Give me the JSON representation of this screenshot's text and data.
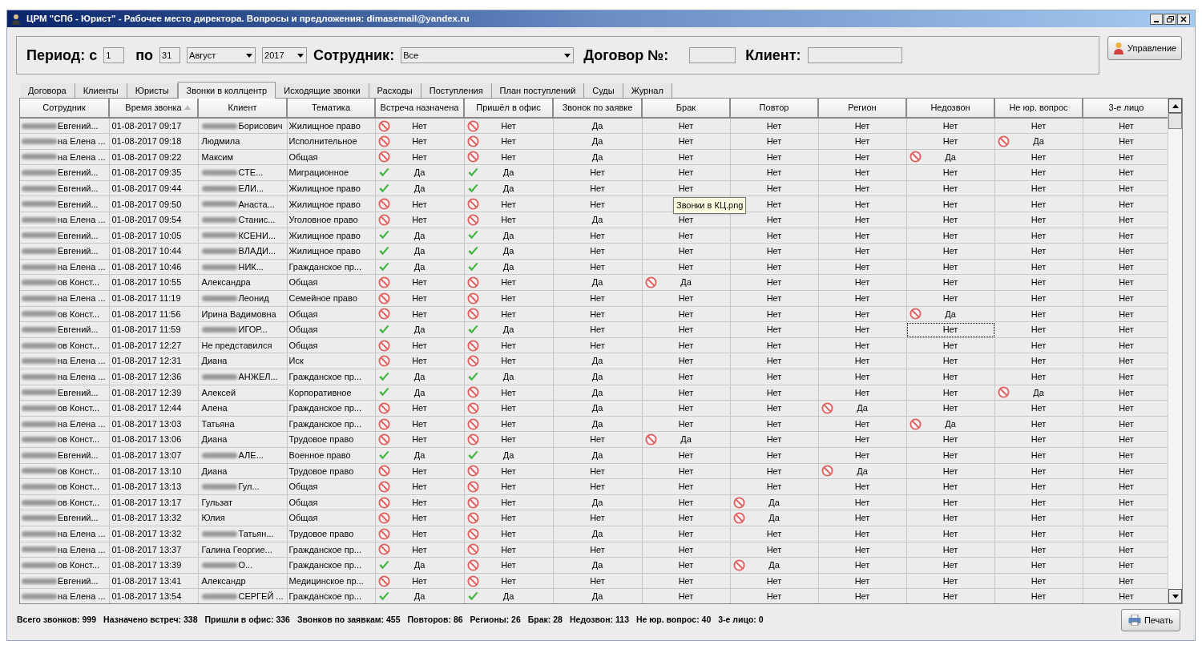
{
  "window": {
    "title": "ЦРМ \"СПб - Юрист\" - Рабочее место директора. Вопросы и предложения: dimasemail@yandex.ru"
  },
  "filter": {
    "period_label": "Период: с",
    "from": "1",
    "to_label": "по",
    "to": "31",
    "month": "Август",
    "year": "2017",
    "employee_label": "Сотрудник:",
    "employee": "Все",
    "contract_label": "Договор №:",
    "client_label": "Клиент:"
  },
  "manage_button": "Управление",
  "tabs": [
    {
      "label": "Договора",
      "selected": false
    },
    {
      "label": "Клиенты",
      "selected": false
    },
    {
      "label": "Юристы",
      "selected": false
    },
    {
      "label": "Звонки в коллцентр",
      "selected": true
    },
    {
      "label": "Исходящие звонки",
      "selected": false
    },
    {
      "label": "Расходы",
      "selected": false
    },
    {
      "label": "Поступления",
      "selected": false
    },
    {
      "label": "План поступлений",
      "selected": false
    },
    {
      "label": "Суды",
      "selected": false
    },
    {
      "label": "Журнал",
      "selected": false
    }
  ],
  "table": {
    "columns": [
      {
        "label": "Сотрудник",
        "sorted": false
      },
      {
        "label": "Время звонка",
        "sorted": true
      },
      {
        "label": "Клиент",
        "sorted": false
      },
      {
        "label": "Тематика",
        "sorted": false
      },
      {
        "label": "Встреча назначена",
        "sorted": false
      },
      {
        "label": "Пришёл в офис",
        "sorted": false
      },
      {
        "label": "Звонок по заявке",
        "sorted": false
      },
      {
        "label": "Брак",
        "sorted": false
      },
      {
        "label": "Повтор",
        "sorted": false
      },
      {
        "label": "Регион",
        "sorted": false
      },
      {
        "label": "Недозвон",
        "sorted": false
      },
      {
        "label": "Не юр. вопрос",
        "sorted": false
      },
      {
        "label": "3-е лицо",
        "sorted": false
      }
    ],
    "rows": [
      {
        "employee": "Евгений...",
        "time": "01-08-2017 09:17",
        "client": "Борисович",
        "client_blurred": true,
        "topic": "Жилищное право",
        "flags": [
          {
            "text": "Нет",
            "kind": "no"
          },
          {
            "text": "Нет",
            "kind": "no"
          },
          {
            "text": "Да",
            "kind": "plain"
          },
          {
            "text": "Нет",
            "kind": "plain"
          },
          {
            "text": "Нет",
            "kind": "plain"
          },
          {
            "text": "Нет",
            "kind": "plain"
          },
          {
            "text": "Нет",
            "kind": "plain"
          },
          {
            "text": "Нет",
            "kind": "plain"
          },
          {
            "text": "Нет",
            "kind": "plain"
          }
        ]
      },
      {
        "employee": "на Елена ...",
        "time": "01-08-2017 09:18",
        "client": "Людмила",
        "client_blurred": false,
        "topic": "Исполнительное",
        "flags": [
          {
            "text": "Нет",
            "kind": "no"
          },
          {
            "text": "Нет",
            "kind": "no"
          },
          {
            "text": "Да",
            "kind": "plain"
          },
          {
            "text": "Нет",
            "kind": "plain"
          },
          {
            "text": "Нет",
            "kind": "plain"
          },
          {
            "text": "Нет",
            "kind": "plain"
          },
          {
            "text": "Нет",
            "kind": "plain"
          },
          {
            "text": "Да",
            "kind": "no"
          },
          {
            "text": "Нет",
            "kind": "plain"
          }
        ]
      },
      {
        "employee": "на Елена ...",
        "time": "01-08-2017 09:22",
        "client": "Максим",
        "client_blurred": false,
        "topic": "Общая",
        "flags": [
          {
            "text": "Нет",
            "kind": "no"
          },
          {
            "text": "Нет",
            "kind": "no"
          },
          {
            "text": "Да",
            "kind": "plain"
          },
          {
            "text": "Нет",
            "kind": "plain"
          },
          {
            "text": "Нет",
            "kind": "plain"
          },
          {
            "text": "Нет",
            "kind": "plain"
          },
          {
            "text": "Да",
            "kind": "no"
          },
          {
            "text": "Нет",
            "kind": "plain"
          },
          {
            "text": "Нет",
            "kind": "plain"
          }
        ]
      },
      {
        "employee": "Евгений...",
        "time": "01-08-2017 09:35",
        "client": "СТЕ...",
        "client_blurred": true,
        "topic": "Миграционное",
        "flags": [
          {
            "text": "Да",
            "kind": "yes"
          },
          {
            "text": "Да",
            "kind": "yes"
          },
          {
            "text": "Нет",
            "kind": "plain"
          },
          {
            "text": "Нет",
            "kind": "plain"
          },
          {
            "text": "Нет",
            "kind": "plain"
          },
          {
            "text": "Нет",
            "kind": "plain"
          },
          {
            "text": "Нет",
            "kind": "plain"
          },
          {
            "text": "Нет",
            "kind": "plain"
          },
          {
            "text": "Нет",
            "kind": "plain"
          }
        ]
      },
      {
        "employee": "Евгений...",
        "time": "01-08-2017 09:44",
        "client": "ЕЛИ...",
        "client_blurred": true,
        "topic": "Жилищное право",
        "flags": [
          {
            "text": "Да",
            "kind": "yes"
          },
          {
            "text": "Да",
            "kind": "yes"
          },
          {
            "text": "Нет",
            "kind": "plain"
          },
          {
            "text": "Нет",
            "kind": "plain"
          },
          {
            "text": "Нет",
            "kind": "plain"
          },
          {
            "text": "Нет",
            "kind": "plain"
          },
          {
            "text": "Нет",
            "kind": "plain"
          },
          {
            "text": "Нет",
            "kind": "plain"
          },
          {
            "text": "Нет",
            "kind": "plain"
          }
        ]
      },
      {
        "employee": "Евгений...",
        "time": "01-08-2017 09:50",
        "client": "Анаста...",
        "client_blurred": true,
        "topic": "Жилищное право",
        "flags": [
          {
            "text": "Нет",
            "kind": "no"
          },
          {
            "text": "Нет",
            "kind": "no"
          },
          {
            "text": "Нет",
            "kind": "plain"
          },
          {
            "kind": "covered"
          },
          {
            "text": "Нет",
            "kind": "plain"
          },
          {
            "text": "Нет",
            "kind": "plain"
          },
          {
            "text": "Нет",
            "kind": "plain"
          },
          {
            "text": "Нет",
            "kind": "plain"
          },
          {
            "text": "Нет",
            "kind": "plain"
          }
        ]
      },
      {
        "employee": "на Елена ...",
        "time": "01-08-2017 09:54",
        "client": "Станис...",
        "client_blurred": true,
        "topic": "Уголовное право",
        "flags": [
          {
            "text": "Нет",
            "kind": "no"
          },
          {
            "text": "Нет",
            "kind": "no"
          },
          {
            "text": "Да",
            "kind": "plain"
          },
          {
            "text": "Нет",
            "kind": "plain"
          },
          {
            "text": "Нет",
            "kind": "plain"
          },
          {
            "text": "Нет",
            "kind": "plain"
          },
          {
            "text": "Нет",
            "kind": "plain"
          },
          {
            "text": "Нет",
            "kind": "plain"
          },
          {
            "text": "Нет",
            "kind": "plain"
          }
        ]
      },
      {
        "employee": "Евгений...",
        "time": "01-08-2017 10:05",
        "client": "КСЕНИ...",
        "client_blurred": true,
        "topic": "Жилищное право",
        "flags": [
          {
            "text": "Да",
            "kind": "yes"
          },
          {
            "text": "Да",
            "kind": "yes"
          },
          {
            "text": "Нет",
            "kind": "plain"
          },
          {
            "text": "Нет",
            "kind": "plain"
          },
          {
            "text": "Нет",
            "kind": "plain"
          },
          {
            "text": "Нет",
            "kind": "plain"
          },
          {
            "text": "Нет",
            "kind": "plain"
          },
          {
            "text": "Нет",
            "kind": "plain"
          },
          {
            "text": "Нет",
            "kind": "plain"
          }
        ]
      },
      {
        "employee": "Евгений...",
        "time": "01-08-2017 10:44",
        "client": "ВЛАДИ...",
        "client_blurred": true,
        "topic": "Жилищное право",
        "flags": [
          {
            "text": "Да",
            "kind": "yes"
          },
          {
            "text": "Да",
            "kind": "yes"
          },
          {
            "text": "Нет",
            "kind": "plain"
          },
          {
            "text": "Нет",
            "kind": "plain"
          },
          {
            "text": "Нет",
            "kind": "plain"
          },
          {
            "text": "Нет",
            "kind": "plain"
          },
          {
            "text": "Нет",
            "kind": "plain"
          },
          {
            "text": "Нет",
            "kind": "plain"
          },
          {
            "text": "Нет",
            "kind": "plain"
          }
        ]
      },
      {
        "employee": "на Елена ...",
        "time": "01-08-2017 10:46",
        "client": "НИК...",
        "client_blurred": true,
        "topic": "Гражданское пр...",
        "flags": [
          {
            "text": "Да",
            "kind": "yes"
          },
          {
            "text": "Да",
            "kind": "yes"
          },
          {
            "text": "Нет",
            "kind": "plain"
          },
          {
            "text": "Нет",
            "kind": "plain"
          },
          {
            "text": "Нет",
            "kind": "plain"
          },
          {
            "text": "Нет",
            "kind": "plain"
          },
          {
            "text": "Нет",
            "kind": "plain"
          },
          {
            "text": "Нет",
            "kind": "plain"
          },
          {
            "text": "Нет",
            "kind": "plain"
          }
        ]
      },
      {
        "employee": "ов Конст...",
        "time": "01-08-2017 10:55",
        "client": "Александра",
        "client_blurred": false,
        "topic": "Общая",
        "flags": [
          {
            "text": "Нет",
            "kind": "no"
          },
          {
            "text": "Нет",
            "kind": "no"
          },
          {
            "text": "Да",
            "kind": "plain"
          },
          {
            "text": "Да",
            "kind": "no"
          },
          {
            "text": "Нет",
            "kind": "plain"
          },
          {
            "text": "Нет",
            "kind": "plain"
          },
          {
            "text": "Нет",
            "kind": "plain"
          },
          {
            "text": "Нет",
            "kind": "plain"
          },
          {
            "text": "Нет",
            "kind": "plain"
          }
        ]
      },
      {
        "employee": "на Елена ...",
        "time": "01-08-2017 11:19",
        "client": "Леонид",
        "client_blurred": true,
        "topic": "Семейное право",
        "flags": [
          {
            "text": "Нет",
            "kind": "no"
          },
          {
            "text": "Нет",
            "kind": "no"
          },
          {
            "text": "Нет",
            "kind": "plain"
          },
          {
            "text": "Нет",
            "kind": "plain"
          },
          {
            "text": "Нет",
            "kind": "plain"
          },
          {
            "text": "Нет",
            "kind": "plain"
          },
          {
            "text": "Нет",
            "kind": "plain"
          },
          {
            "text": "Нет",
            "kind": "plain"
          },
          {
            "text": "Нет",
            "kind": "plain"
          }
        ]
      },
      {
        "employee": "ов Конст...",
        "time": "01-08-2017 11:56",
        "client": "Ирина Вадимовна",
        "client_blurred": false,
        "topic": "Общая",
        "flags": [
          {
            "text": "Нет",
            "kind": "no"
          },
          {
            "text": "Нет",
            "kind": "no"
          },
          {
            "text": "Нет",
            "kind": "plain"
          },
          {
            "text": "Нет",
            "kind": "plain"
          },
          {
            "text": "Нет",
            "kind": "plain"
          },
          {
            "text": "Нет",
            "kind": "plain"
          },
          {
            "text": "Да",
            "kind": "no"
          },
          {
            "text": "Нет",
            "kind": "plain"
          },
          {
            "text": "Нет",
            "kind": "plain"
          }
        ]
      },
      {
        "employee": "Евгений...",
        "time": "01-08-2017 11:59",
        "client": "ИГОР...",
        "client_blurred": true,
        "topic": "Общая",
        "flags": [
          {
            "text": "Да",
            "kind": "yes"
          },
          {
            "text": "Да",
            "kind": "yes"
          },
          {
            "text": "Нет",
            "kind": "plain"
          },
          {
            "text": "Нет",
            "kind": "plain"
          },
          {
            "text": "Нет",
            "kind": "plain"
          },
          {
            "text": "Нет",
            "kind": "plain"
          },
          {
            "text": "Нет",
            "kind": "plain",
            "focused": true
          },
          {
            "text": "Нет",
            "kind": "plain"
          },
          {
            "text": "Нет",
            "kind": "plain"
          }
        ]
      },
      {
        "employee": "ов Конст...",
        "time": "01-08-2017 12:27",
        "client": "Не представился",
        "client_blurred": false,
        "topic": "Общая",
        "flags": [
          {
            "text": "Нет",
            "kind": "no"
          },
          {
            "text": "Нет",
            "kind": "no"
          },
          {
            "text": "Нет",
            "kind": "plain"
          },
          {
            "text": "Нет",
            "kind": "plain"
          },
          {
            "text": "Нет",
            "kind": "plain"
          },
          {
            "text": "Нет",
            "kind": "plain"
          },
          {
            "text": "Нет",
            "kind": "plain"
          },
          {
            "text": "Нет",
            "kind": "plain"
          },
          {
            "text": "Нет",
            "kind": "plain"
          }
        ]
      },
      {
        "employee": "на Елена ...",
        "time": "01-08-2017 12:31",
        "client": "Диана",
        "client_blurred": false,
        "topic": "Иск",
        "flags": [
          {
            "text": "Нет",
            "kind": "no"
          },
          {
            "text": "Нет",
            "kind": "no"
          },
          {
            "text": "Да",
            "kind": "plain"
          },
          {
            "text": "Нет",
            "kind": "plain"
          },
          {
            "text": "Нет",
            "kind": "plain"
          },
          {
            "text": "Нет",
            "kind": "plain"
          },
          {
            "text": "Нет",
            "kind": "plain"
          },
          {
            "text": "Нет",
            "kind": "plain"
          },
          {
            "text": "Нет",
            "kind": "plain"
          }
        ]
      },
      {
        "employee": "на Елена ...",
        "time": "01-08-2017 12:36",
        "client": "АНЖЕЛ...",
        "client_blurred": true,
        "topic": "Гражданское пр...",
        "flags": [
          {
            "text": "Да",
            "kind": "yes"
          },
          {
            "text": "Да",
            "kind": "yes"
          },
          {
            "text": "Да",
            "kind": "plain"
          },
          {
            "text": "Нет",
            "kind": "plain"
          },
          {
            "text": "Нет",
            "kind": "plain"
          },
          {
            "text": "Нет",
            "kind": "plain"
          },
          {
            "text": "Нет",
            "kind": "plain"
          },
          {
            "text": "Нет",
            "kind": "plain"
          },
          {
            "text": "Нет",
            "kind": "plain"
          }
        ]
      },
      {
        "employee": "Евгений...",
        "time": "01-08-2017 12:39",
        "client": "Алексей",
        "client_blurred": false,
        "topic": "Корпоративное",
        "flags": [
          {
            "text": "Да",
            "kind": "yes"
          },
          {
            "text": "Нет",
            "kind": "no"
          },
          {
            "text": "Да",
            "kind": "plain"
          },
          {
            "text": "Нет",
            "kind": "plain"
          },
          {
            "text": "Нет",
            "kind": "plain"
          },
          {
            "text": "Нет",
            "kind": "plain"
          },
          {
            "text": "Нет",
            "kind": "plain"
          },
          {
            "text": "Да",
            "kind": "no"
          },
          {
            "text": "Нет",
            "kind": "plain"
          }
        ]
      },
      {
        "employee": "ов Конст...",
        "time": "01-08-2017 12:44",
        "client": "Алена",
        "client_blurred": false,
        "topic": "Гражданское пр...",
        "flags": [
          {
            "text": "Нет",
            "kind": "no"
          },
          {
            "text": "Нет",
            "kind": "no"
          },
          {
            "text": "Да",
            "kind": "plain"
          },
          {
            "text": "Нет",
            "kind": "plain"
          },
          {
            "text": "Нет",
            "kind": "plain"
          },
          {
            "text": "Да",
            "kind": "no"
          },
          {
            "text": "Нет",
            "kind": "plain"
          },
          {
            "text": "Нет",
            "kind": "plain"
          },
          {
            "text": "Нет",
            "kind": "plain"
          }
        ]
      },
      {
        "employee": "на Елена ...",
        "time": "01-08-2017 13:03",
        "client": "Татьяна",
        "client_blurred": false,
        "topic": "Гражданское пр...",
        "flags": [
          {
            "text": "Нет",
            "kind": "no"
          },
          {
            "text": "Нет",
            "kind": "no"
          },
          {
            "text": "Да",
            "kind": "plain"
          },
          {
            "text": "Нет",
            "kind": "plain"
          },
          {
            "text": "Нет",
            "kind": "plain"
          },
          {
            "text": "Нет",
            "kind": "plain"
          },
          {
            "text": "Да",
            "kind": "no"
          },
          {
            "text": "Нет",
            "kind": "plain"
          },
          {
            "text": "Нет",
            "kind": "plain"
          }
        ]
      },
      {
        "employee": "ов Конст...",
        "time": "01-08-2017 13:06",
        "client": "Диана",
        "client_blurred": false,
        "topic": "Трудовое право",
        "flags": [
          {
            "text": "Нет",
            "kind": "no"
          },
          {
            "text": "Нет",
            "kind": "no"
          },
          {
            "text": "Нет",
            "kind": "plain"
          },
          {
            "text": "Да",
            "kind": "no"
          },
          {
            "text": "Нет",
            "kind": "plain"
          },
          {
            "text": "Нет",
            "kind": "plain"
          },
          {
            "text": "Нет",
            "kind": "plain"
          },
          {
            "text": "Нет",
            "kind": "plain"
          },
          {
            "text": "Нет",
            "kind": "plain"
          }
        ]
      },
      {
        "employee": "Евгений...",
        "time": "01-08-2017 13:07",
        "client": "АЛЕ...",
        "client_blurred": true,
        "topic": "Военное право",
        "flags": [
          {
            "text": "Да",
            "kind": "yes"
          },
          {
            "text": "Да",
            "kind": "yes"
          },
          {
            "text": "Да",
            "kind": "plain"
          },
          {
            "text": "Нет",
            "kind": "plain"
          },
          {
            "text": "Нет",
            "kind": "plain"
          },
          {
            "text": "Нет",
            "kind": "plain"
          },
          {
            "text": "Нет",
            "kind": "plain"
          },
          {
            "text": "Нет",
            "kind": "plain"
          },
          {
            "text": "Нет",
            "kind": "plain"
          }
        ]
      },
      {
        "employee": "ов Конст...",
        "time": "01-08-2017 13:10",
        "client": "Диана",
        "client_blurred": false,
        "topic": "Трудовое право",
        "flags": [
          {
            "text": "Нет",
            "kind": "no"
          },
          {
            "text": "Нет",
            "kind": "no"
          },
          {
            "text": "Нет",
            "kind": "plain"
          },
          {
            "text": "Нет",
            "kind": "plain"
          },
          {
            "text": "Нет",
            "kind": "plain"
          },
          {
            "text": "Да",
            "kind": "no"
          },
          {
            "text": "Нет",
            "kind": "plain"
          },
          {
            "text": "Нет",
            "kind": "plain"
          },
          {
            "text": "Нет",
            "kind": "plain"
          }
        ]
      },
      {
        "employee": "ов Конст...",
        "time": "01-08-2017 13:13",
        "client": "Гул...",
        "client_blurred": true,
        "topic": "Общая",
        "flags": [
          {
            "text": "Нет",
            "kind": "no"
          },
          {
            "text": "Нет",
            "kind": "no"
          },
          {
            "text": "Нет",
            "kind": "plain"
          },
          {
            "text": "Нет",
            "kind": "plain"
          },
          {
            "text": "Нет",
            "kind": "plain"
          },
          {
            "text": "Нет",
            "kind": "plain"
          },
          {
            "text": "Нет",
            "kind": "plain"
          },
          {
            "text": "Нет",
            "kind": "plain"
          },
          {
            "text": "Нет",
            "kind": "plain"
          }
        ]
      },
      {
        "employee": "ов Конст...",
        "time": "01-08-2017 13:17",
        "client": "Гульзат",
        "client_blurred": false,
        "topic": "Общая",
        "flags": [
          {
            "text": "Нет",
            "kind": "no"
          },
          {
            "text": "Нет",
            "kind": "no"
          },
          {
            "text": "Да",
            "kind": "plain"
          },
          {
            "text": "Нет",
            "kind": "plain"
          },
          {
            "text": "Да",
            "kind": "no"
          },
          {
            "text": "Нет",
            "kind": "plain"
          },
          {
            "text": "Нет",
            "kind": "plain"
          },
          {
            "text": "Нет",
            "kind": "plain"
          },
          {
            "text": "Нет",
            "kind": "plain"
          }
        ]
      },
      {
        "employee": "Евгений...",
        "time": "01-08-2017 13:32",
        "client": "Юлия",
        "client_blurred": false,
        "topic": "Общая",
        "flags": [
          {
            "text": "Нет",
            "kind": "no"
          },
          {
            "text": "Нет",
            "kind": "no"
          },
          {
            "text": "Нет",
            "kind": "plain"
          },
          {
            "text": "Нет",
            "kind": "plain"
          },
          {
            "text": "Да",
            "kind": "no"
          },
          {
            "text": "Нет",
            "kind": "plain"
          },
          {
            "text": "Нет",
            "kind": "plain"
          },
          {
            "text": "Нет",
            "kind": "plain"
          },
          {
            "text": "Нет",
            "kind": "plain"
          }
        ]
      },
      {
        "employee": "на Елена ...",
        "time": "01-08-2017 13:32",
        "client": "Татьян...",
        "client_blurred": true,
        "topic": "Трудовое право",
        "flags": [
          {
            "text": "Нет",
            "kind": "no"
          },
          {
            "text": "Нет",
            "kind": "no"
          },
          {
            "text": "Да",
            "kind": "plain"
          },
          {
            "text": "Нет",
            "kind": "plain"
          },
          {
            "text": "Нет",
            "kind": "plain"
          },
          {
            "text": "Нет",
            "kind": "plain"
          },
          {
            "text": "Нет",
            "kind": "plain"
          },
          {
            "text": "Нет",
            "kind": "plain"
          },
          {
            "text": "Нет",
            "kind": "plain"
          }
        ]
      },
      {
        "employee": "на Елена ...",
        "time": "01-08-2017 13:37",
        "client": "Галина Георгие...",
        "client_blurred": false,
        "topic": "Гражданское пр...",
        "flags": [
          {
            "text": "Нет",
            "kind": "no"
          },
          {
            "text": "Нет",
            "kind": "no"
          },
          {
            "text": "Нет",
            "kind": "plain"
          },
          {
            "text": "Нет",
            "kind": "plain"
          },
          {
            "text": "Нет",
            "kind": "plain"
          },
          {
            "text": "Нет",
            "kind": "plain"
          },
          {
            "text": "Нет",
            "kind": "plain"
          },
          {
            "text": "Нет",
            "kind": "plain"
          },
          {
            "text": "Нет",
            "kind": "plain"
          }
        ]
      },
      {
        "employee": "ов Конст...",
        "time": "01-08-2017 13:39",
        "client": "О...",
        "client_blurred": true,
        "topic": "Гражданское пр...",
        "flags": [
          {
            "text": "Да",
            "kind": "yes"
          },
          {
            "text": "Нет",
            "kind": "no"
          },
          {
            "text": "Да",
            "kind": "plain"
          },
          {
            "text": "Нет",
            "kind": "plain"
          },
          {
            "text": "Да",
            "kind": "no"
          },
          {
            "text": "Нет",
            "kind": "plain"
          },
          {
            "text": "Нет",
            "kind": "plain"
          },
          {
            "text": "Нет",
            "kind": "plain"
          },
          {
            "text": "Нет",
            "kind": "plain"
          }
        ]
      },
      {
        "employee": "Евгений...",
        "time": "01-08-2017 13:41",
        "client": "Александр",
        "client_blurred": false,
        "topic": "Медицинское пр...",
        "flags": [
          {
            "text": "Нет",
            "kind": "no"
          },
          {
            "text": "Нет",
            "kind": "no"
          },
          {
            "text": "Нет",
            "kind": "plain"
          },
          {
            "text": "Нет",
            "kind": "plain"
          },
          {
            "text": "Нет",
            "kind": "plain"
          },
          {
            "text": "Нет",
            "kind": "plain"
          },
          {
            "text": "Нет",
            "kind": "plain"
          },
          {
            "text": "Нет",
            "kind": "plain"
          },
          {
            "text": "Нет",
            "kind": "plain"
          }
        ]
      },
      {
        "employee": "на Елена ...",
        "time": "01-08-2017 13:54",
        "client": "СЕРГЕЙ ...",
        "client_blurred": true,
        "topic": "Гражданское пр...",
        "flags": [
          {
            "text": "Да",
            "kind": "yes"
          },
          {
            "text": "Да",
            "kind": "yes"
          },
          {
            "text": "Да",
            "kind": "plain"
          },
          {
            "text": "Нет",
            "kind": "plain"
          },
          {
            "text": "Нет",
            "kind": "plain"
          },
          {
            "text": "Нет",
            "kind": "plain"
          },
          {
            "text": "Нет",
            "kind": "plain"
          },
          {
            "text": "Нет",
            "kind": "plain"
          },
          {
            "text": "Нет",
            "kind": "plain"
          }
        ]
      }
    ]
  },
  "tooltip": "Звонки в КЦ.png",
  "summary": [
    "Всего звонков: 999",
    "Назначено встреч: 338",
    "Пришли в офис: 336",
    "Звонков по заявкам: 455",
    "Повторов: 86",
    "Регионы: 26",
    "Брак: 28",
    "Недозвон: 113",
    "Не юр. вопрос: 40",
    "3-е лицо: 0"
  ],
  "print_button": "Печать"
}
